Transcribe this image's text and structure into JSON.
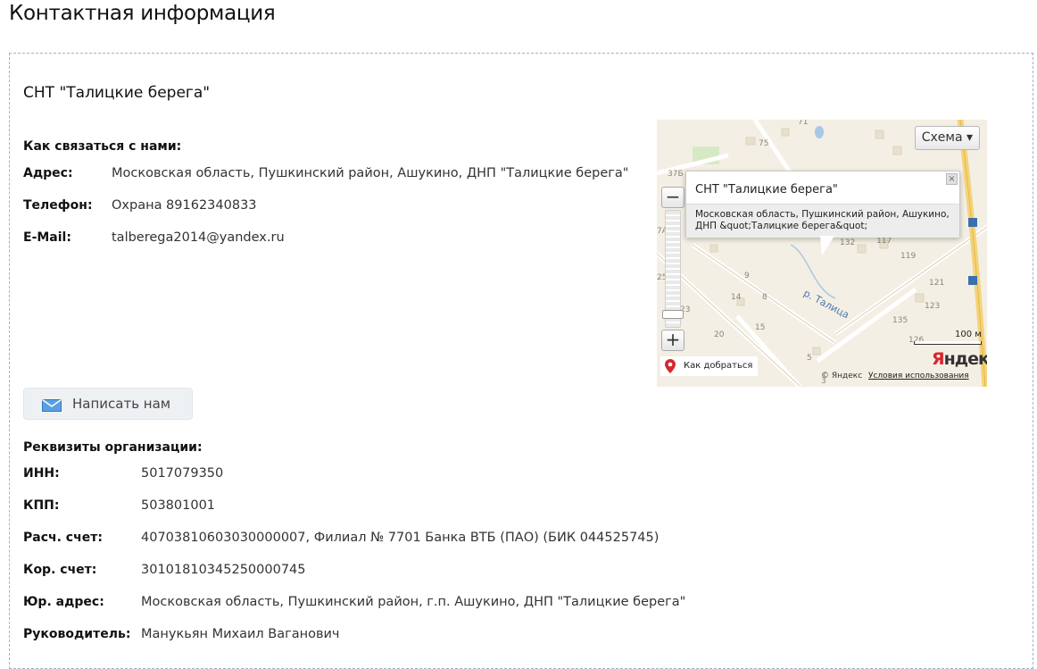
{
  "page": {
    "title": "Контактная информация"
  },
  "org": {
    "name": "СНТ \"Талицкие берега\""
  },
  "contacts": {
    "heading": "Как связаться с нами:",
    "address_label": "Адрес:",
    "address_value": "Московская область, Пушкинский район, Ашукино, ДНП \"Талицкие берега\"",
    "phone_label": "Телефон:",
    "phone_value": "Охрана 89162340833",
    "email_label": "E-Mail:",
    "email_value": "talberega2014@yandex.ru"
  },
  "write_button": {
    "label": "Написать нам",
    "icon": "mail-icon"
  },
  "map": {
    "type_button": "Схема ▾",
    "zoom_in": "+",
    "zoom_out": "−",
    "zoom_level": 0.92,
    "balloon_title": "СНТ \"Талицкие берега\"",
    "balloon_text": "Московская область, Пушкинский район, Ашукино, ДНП &quot;Талицкие берега&quot;",
    "balloon_close": "×",
    "route_label": "Как добраться",
    "scale_label": "100 м",
    "logo_first": "Я",
    "logo_rest": "ндекс",
    "copyright": "© Яндекс",
    "terms": "Условия использования",
    "river_label": "р. Талица",
    "labels": [
      "71",
      "75",
      "37Б",
      "7А",
      "25",
      "23",
      "132",
      "117",
      "119",
      "121",
      "123",
      "135",
      "126",
      "9",
      "14",
      "8",
      "15",
      "20",
      "5",
      "3"
    ],
    "colors": {
      "water": "#a9c7e6",
      "road_major": "#f5d37a",
      "building": "#e0d9c9"
    }
  },
  "requisites": {
    "heading": "Реквизиты организации:",
    "rows": [
      {
        "label": "ИНН:",
        "value": "5017079350"
      },
      {
        "label": "КПП:",
        "value": "503801001"
      },
      {
        "label": "Расч. счет:",
        "value": "40703810603030000007, Филиал № 7701 Банка ВТБ (ПАО) (БИК 044525745)"
      },
      {
        "label": "Кор. счет:",
        "value": "30101810345250000745"
      },
      {
        "label": "Юр. адрес:",
        "value": "Московская область, Пушкинский район, г.п. Ашукино, ДНП \"Талицкие берега\""
      },
      {
        "label": "Руководитель:",
        "value": "Манукьян Михаил Ваганович"
      }
    ]
  }
}
